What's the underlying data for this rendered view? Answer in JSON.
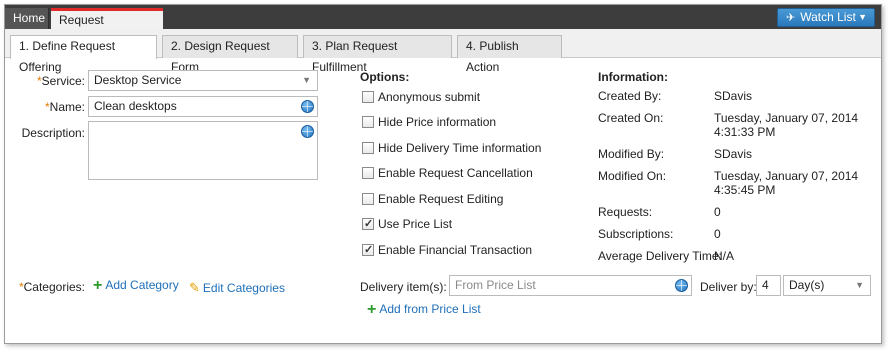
{
  "topbar": {
    "home_tab": "Home",
    "active_tab": "Request Offering",
    "watch_list": "Watch List"
  },
  "steps": [
    "1. Define Request Offering",
    "2. Design Request Form",
    "3. Plan Request Fulfillment",
    "4. Publish Action"
  ],
  "form": {
    "service_label": "Service:",
    "service_value": "Desktop Service",
    "name_label": "Name:",
    "name_value": "Clean desktops",
    "description_label": "Description:",
    "description_value": "",
    "categories_label": "Categories:",
    "add_category": "Add Category",
    "edit_categories": "Edit Categories"
  },
  "options": {
    "title": "Options:",
    "items": [
      {
        "label": "Anonymous submit",
        "checked": false
      },
      {
        "label": "Hide Price information",
        "checked": false
      },
      {
        "label": "Hide Delivery Time information",
        "checked": false
      },
      {
        "label": "Enable Request Cancellation",
        "checked": false
      },
      {
        "label": "Enable Request Editing",
        "checked": false
      },
      {
        "label": "Use Price List",
        "checked": true
      },
      {
        "label": "Enable Financial Transaction",
        "checked": true
      }
    ]
  },
  "information": {
    "title": "Information:",
    "created_by_label": "Created By:",
    "created_by": "SDavis",
    "created_on_label": "Created On:",
    "created_on_date": "Tuesday, January 07, 2014",
    "created_on_time": "4:31:33 PM",
    "modified_by_label": "Modified By:",
    "modified_by": "SDavis",
    "modified_on_label": "Modified On:",
    "modified_on_date": "Tuesday, January 07, 2014",
    "modified_on_time": "4:35:45 PM",
    "requests_label": "Requests:",
    "requests": "0",
    "subscriptions_label": "Subscriptions:",
    "subscriptions": "0",
    "avg_delivery_label": "Average Delivery Time:",
    "avg_delivery": "N/A"
  },
  "delivery": {
    "items_label": "Delivery item(s):",
    "items_placeholder": "From Price List",
    "deliver_by_label": "Deliver by:",
    "deliver_by_value": "4",
    "deliver_by_unit": "Day(s)",
    "add_from_price_list": "Add from Price List"
  },
  "colors": {
    "accent": "#2a78bb",
    "active_tab_marker": "#e12b2b",
    "required_marker": "#e07b00",
    "link": "#1f6fb8",
    "add_icon": "#2a9a2a"
  }
}
